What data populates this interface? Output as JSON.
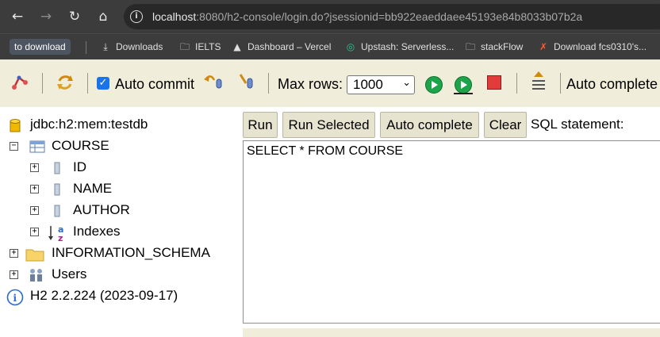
{
  "browser": {
    "nav": {
      "back_icon": "arrow-left-icon",
      "forward_icon": "arrow-right-icon",
      "reload_icon": "reload-icon",
      "home_icon": "home-icon"
    },
    "url_host": "localhost",
    "url_rest": ":8080/h2-console/login.do?jsessionid=bb922eaeddaee45193e84b8033b07b2a",
    "bookmarks": [
      {
        "label": "to download",
        "icon": ""
      },
      {
        "label": "Downloads",
        "icon": "download-icon"
      },
      {
        "label": "IELTS",
        "icon": "folder-icon"
      },
      {
        "label": "Dashboard – Vercel",
        "icon": "vercel-icon"
      },
      {
        "label": "Upstash: Serverless...",
        "icon": "upstash-icon"
      },
      {
        "label": "stackFlow",
        "icon": "folder-icon"
      },
      {
        "label": "Download fcs0310's...",
        "icon": "x-logo-icon"
      }
    ]
  },
  "toolbar": {
    "auto_commit_label": "Auto commit",
    "auto_commit_checked": true,
    "max_rows_label": "Max rows:",
    "max_rows_value": "1000",
    "auto_complete_label": "Auto complete"
  },
  "tree": {
    "connection": "jdbc:h2:mem:testdb",
    "table": "COURSE",
    "columns": [
      "ID",
      "NAME",
      "AUTHOR"
    ],
    "indexes": "Indexes",
    "schema": "INFORMATION_SCHEMA",
    "users": "Users",
    "version": "H2 2.2.224 (2023-09-17)"
  },
  "sql": {
    "buttons": {
      "run": "Run",
      "run_selected": "Run Selected",
      "auto_complete": "Auto complete",
      "clear": "Clear"
    },
    "label": "SQL statement:",
    "statement": "SELECT * FROM COURSE"
  },
  "colors": {
    "toolbar_bg": "#f0edda",
    "button_bg": "#e6e3cf",
    "chrome_bg": "#3c3c3c"
  }
}
